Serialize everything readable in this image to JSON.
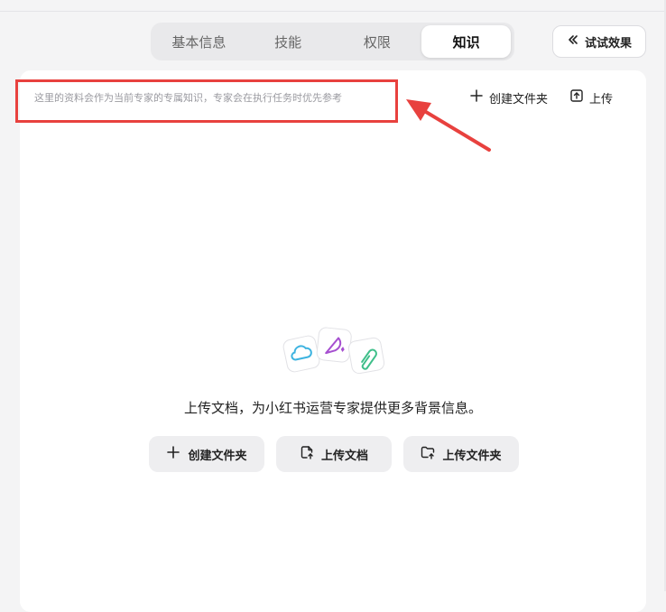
{
  "tabs": [
    {
      "label": "基本信息",
      "active": false
    },
    {
      "label": "技能",
      "active": false
    },
    {
      "label": "权限",
      "active": false
    },
    {
      "label": "知识",
      "active": true
    }
  ],
  "try_button": {
    "label": "试试效果",
    "icon": "double-chevron-left-icon"
  },
  "knowledge": {
    "hint": "这里的资料会作为当前专家的专属知识，专家会在执行任务时优先参考",
    "top_actions": {
      "create_folder": {
        "label": "创建文件夹",
        "icon": "plus-icon"
      },
      "upload": {
        "label": "上传",
        "icon": "upload-icon"
      }
    },
    "empty_state": {
      "message": "上传文档，为小红书运营专家提供更多背景信息。",
      "illustration_icons": [
        "cloud-icon",
        "feather-icon",
        "paperclip-icon"
      ],
      "buttons": [
        {
          "label": "创建文件夹",
          "icon": "plus-icon"
        },
        {
          "label": "上传文档",
          "icon": "file-upload-icon"
        },
        {
          "label": "上传文件夹",
          "icon": "folder-upload-icon"
        }
      ]
    }
  },
  "annotation": {
    "color": "#e8413e"
  }
}
